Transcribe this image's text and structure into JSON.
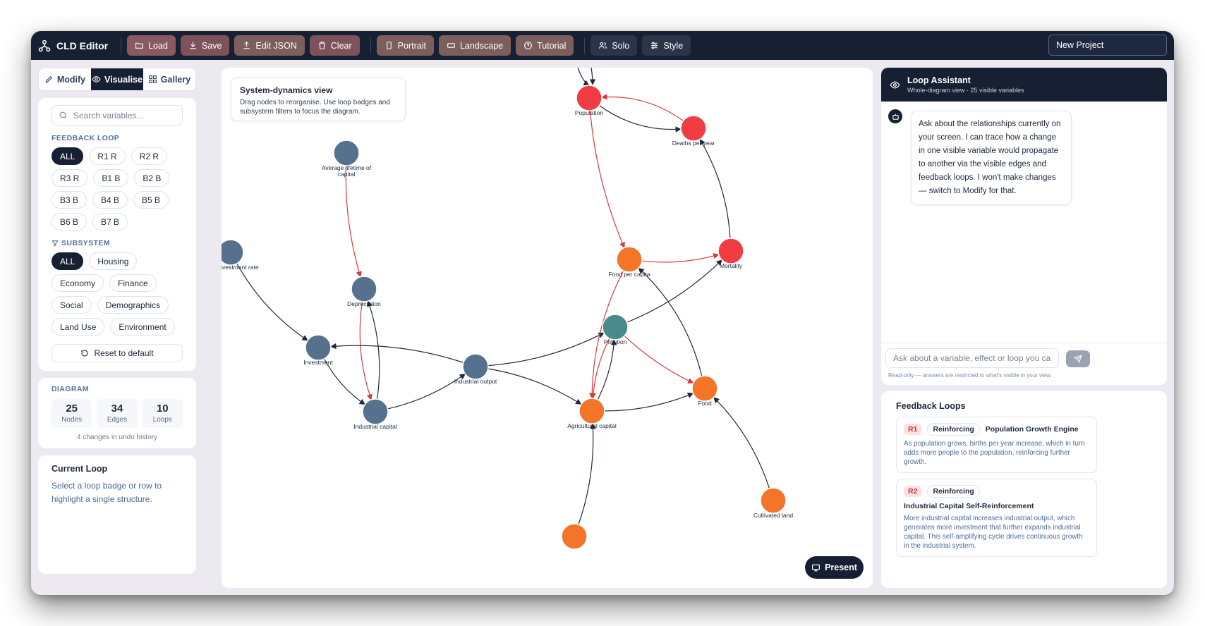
{
  "app": {
    "title": "CLD Editor",
    "project_name": "New Project"
  },
  "toolbar": {
    "load": "Load",
    "save": "Save",
    "edit_json": "Edit JSON",
    "clear": "Clear",
    "portrait": "Portrait",
    "landscape": "Landscape",
    "tutorial": "Tutorial",
    "solo": "Solo",
    "style": "Style"
  },
  "mode_tabs": {
    "modify": "Modify",
    "visualise": "Visualise",
    "gallery": "Gallery",
    "active": "Visualise"
  },
  "filters": {
    "search_placeholder": "Search variables...",
    "feedback_loop_label": "FEEDBACK LOOP",
    "loops": [
      "ALL",
      "R1 R",
      "R2 R",
      "R3 R",
      "B1 B",
      "B2 B",
      "B3 B",
      "B4 B",
      "B5 B",
      "B6 B",
      "B7 B"
    ],
    "subsystem_label": "SUBSYSTEM",
    "subsystems": [
      "ALL",
      "Housing",
      "Economy",
      "Finance",
      "Social",
      "Demographics",
      "Land Use",
      "Environment"
    ],
    "reset_label": "Reset to default"
  },
  "diagram_stats": {
    "label": "DIAGRAM",
    "nodes": "25",
    "nodes_label": "Nodes",
    "edges": "34",
    "edges_label": "Edges",
    "loops": "10",
    "loops_label": "Loops",
    "undo_note": "4 changes in undo history"
  },
  "current_loop": {
    "title": "Current Loop",
    "text": "Select a loop badge or row to highlight a single structure."
  },
  "canvas": {
    "view_title": "System-dynamics view",
    "view_desc": "Drag nodes to reorganise. Use loop badges and subsystem filters to focus the diagram.",
    "present_label": "Present",
    "colors": {
      "economy": "#56718e",
      "demographics": "#f23c44",
      "agriculture": "#f47428",
      "environment": "#4a8a8a",
      "edge": "#1e293b",
      "loop_edge": "#d63a3a"
    },
    "nodes": [
      {
        "id": "population",
        "label": "Population",
        "group": "demographics"
      },
      {
        "id": "deaths",
        "label": "Deaths per year",
        "group": "demographics"
      },
      {
        "id": "avg_lifetime",
        "label": "Average lifetime of capital",
        "group": "economy"
      },
      {
        "id": "investment_rate",
        "label": "Investment rate",
        "group": "economy"
      },
      {
        "id": "food_pc",
        "label": "Food per capita",
        "group": "agriculture"
      },
      {
        "id": "mortality",
        "label": "Mortality",
        "group": "demographics"
      },
      {
        "id": "depreciation",
        "label": "Depreciation",
        "group": "economy"
      },
      {
        "id": "pollution",
        "label": "Pollution",
        "group": "environment"
      },
      {
        "id": "investment",
        "label": "Investment",
        "group": "economy"
      },
      {
        "id": "industrial_output",
        "label": "Industrial output",
        "group": "economy"
      },
      {
        "id": "food",
        "label": "Food",
        "group": "agriculture"
      },
      {
        "id": "industrial_capital",
        "label": "Industrial capital",
        "group": "economy"
      },
      {
        "id": "agri_capital",
        "label": "Agricultural capital",
        "group": "agriculture"
      },
      {
        "id": "cultivated_land",
        "label": "Cultivated land",
        "group": "agriculture"
      },
      {
        "id": "bottom_node",
        "label": "",
        "group": "agriculture"
      }
    ]
  },
  "assistant": {
    "title": "Loop Assistant",
    "subtitle": "Whole-diagram view · 25 visible variables",
    "message": "Ask about the relationships currently on your screen. I can trace how a change in one visible variable would propagate to another via the visible edges and feedback loops. I won't make changes — switch to Modify for that.",
    "input_placeholder": "Ask about a variable, effect or loop you can see...",
    "readonly_note": "Read-only — answers are restricted to what's visible in your view."
  },
  "feedback_loops": {
    "title": "Feedback Loops",
    "items": [
      {
        "id": "R1",
        "type": "Reinforcing",
        "name": "Population Growth Engine",
        "desc": "As population grows, births per year increase, which in turn adds more people to the population, reinforcing further growth."
      },
      {
        "id": "R2",
        "type": "Reinforcing",
        "name": "Industrial Capital Self-Reinforcement",
        "desc": "More industrial capital increases industrial output, which generates more investment that further expands industrial capital. This self-amplifying cycle drives continuous growth in the industrial system."
      }
    ]
  }
}
